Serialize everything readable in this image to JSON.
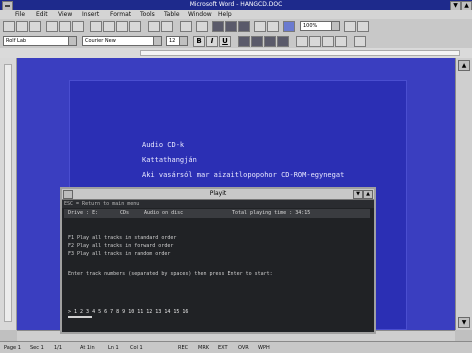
{
  "window": {
    "title": "Microsoft Word - HANGCD.DOC",
    "controls": [
      "▼",
      "▲"
    ]
  },
  "menu": {
    "items": [
      "File",
      "Edit",
      "View",
      "Insert",
      "Format",
      "Tools",
      "Table",
      "Window",
      "Help"
    ]
  },
  "toolbar": {
    "style_value": "Rolf Lab",
    "font_value": "Courier New",
    "size_value": "12",
    "bold_label": "B",
    "italic_label": "I",
    "underline_label": "U",
    "zoom_value": "100%"
  },
  "document": {
    "lines": [
      "Audio CD-k",
      "Kattathangján",
      "Aki vasársól mar aizaitlopopohor CD-ROM-egynegat"
    ]
  },
  "dos_window": {
    "title": "Playit",
    "help_line": "ESC = Return to main menu",
    "header": [
      "Drive : E:",
      "CDs",
      "Audio on disc",
      "Total playing time : 34:15"
    ],
    "options": [
      "F1 Play all tracks in standard order",
      "F2 Play all tracks in forward order",
      "F3 Play all tracks in random order"
    ],
    "prompt": "Enter track numbers (separated by spaces) then press Enter to start:",
    "track_row": "> 1 2 3 4 5 6 7 8 9 10 11 12 13 14 15 16"
  },
  "statusbar": {
    "items": [
      "Page 1",
      "Sec 1",
      "1/1",
      "At 1in",
      "Ln 1",
      "Col 1",
      "REC",
      "MRK",
      "EXT",
      "OVR",
      "WPH"
    ]
  }
}
